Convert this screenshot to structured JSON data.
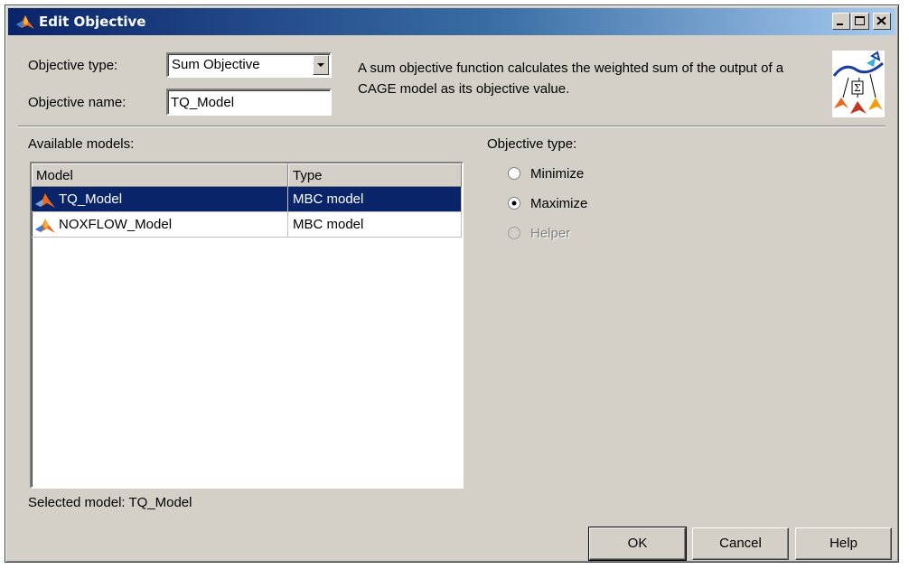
{
  "window": {
    "title": "Edit Objective"
  },
  "form": {
    "objective_type_label": "Objective type:",
    "objective_type_value": "Sum Objective",
    "objective_name_label": "Objective name:",
    "objective_name_value": "TQ_Model",
    "description": "A sum objective function calculates the weighted sum of the output of a CAGE model as its objective value."
  },
  "models": {
    "label": "Available models:",
    "columns": [
      "Model",
      "Type"
    ],
    "rows": [
      {
        "model": "TQ_Model",
        "type": "MBC model",
        "selected": true
      },
      {
        "model": "NOXFLOW_Model",
        "type": "MBC model",
        "selected": false
      }
    ],
    "selected_text": "Selected model: TQ_Model"
  },
  "objective": {
    "label": "Objective type:",
    "options": [
      {
        "label": "Minimize",
        "checked": false,
        "enabled": true
      },
      {
        "label": "Maximize",
        "checked": true,
        "enabled": true
      },
      {
        "label": "Helper",
        "checked": false,
        "enabled": false
      }
    ]
  },
  "buttons": {
    "ok": "OK",
    "cancel": "Cancel",
    "help": "Help"
  },
  "colors": {
    "title_bar_start": "#0a246a",
    "title_bar_end": "#a6caf0",
    "selection": "#0a246a",
    "dialog_face": "#d4d0c8"
  }
}
